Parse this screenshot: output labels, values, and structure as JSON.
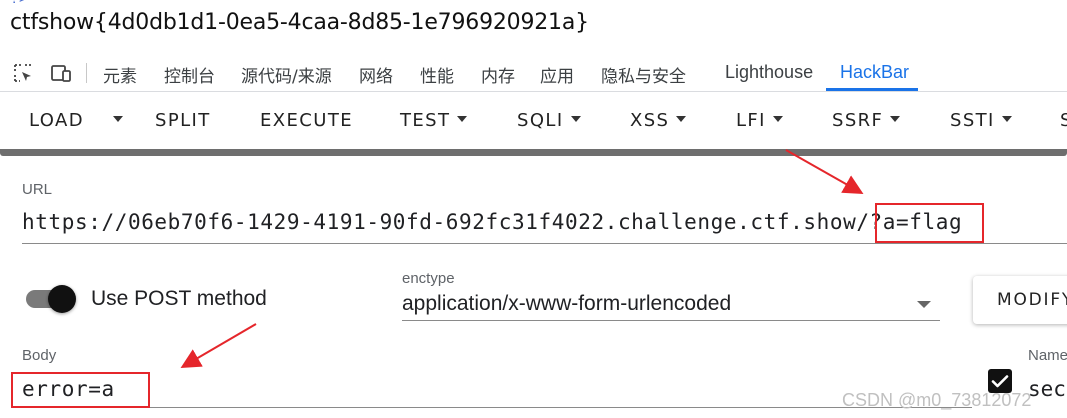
{
  "flag_text": "ctfshow{4d0db1d1-0ea5-4caa-8d85-1e796920921a}",
  "devtools": {
    "tabs": [
      "元素",
      "控制台",
      "源代码/来源",
      "网络",
      "性能",
      "内存",
      "应用",
      "隐私与安全",
      "Lighthouse",
      "HackBar"
    ],
    "active_tab": "HackBar",
    "accent": "#1a73e8"
  },
  "hackbar": {
    "toolbar": {
      "load": "LOAD",
      "split": "SPLIT",
      "execute": "EXECUTE",
      "test": "TEST",
      "sqli": "SQLI",
      "xss": "XSS",
      "lfi": "LFI",
      "ssrf": "SSRF",
      "ssti": "SSTI",
      "next_cut": "S"
    },
    "url_label": "URL",
    "url_value": "https://06eb70f6-1429-4191-90fd-692fc31f4022.challenge.ctf.show/?a=flag",
    "use_post_label": "Use POST method",
    "use_post_enabled": true,
    "enctype_label": "enctype",
    "enctype_value": "application/x-www-form-urlencoded",
    "modify_label": "MODIFY",
    "body_label": "Body",
    "body_value": "error=a",
    "name_label": "Name",
    "header_checked": true,
    "header_value": "sec"
  },
  "watermark": "CSDN @m0_73812072",
  "highlight_color": "#e5262b"
}
